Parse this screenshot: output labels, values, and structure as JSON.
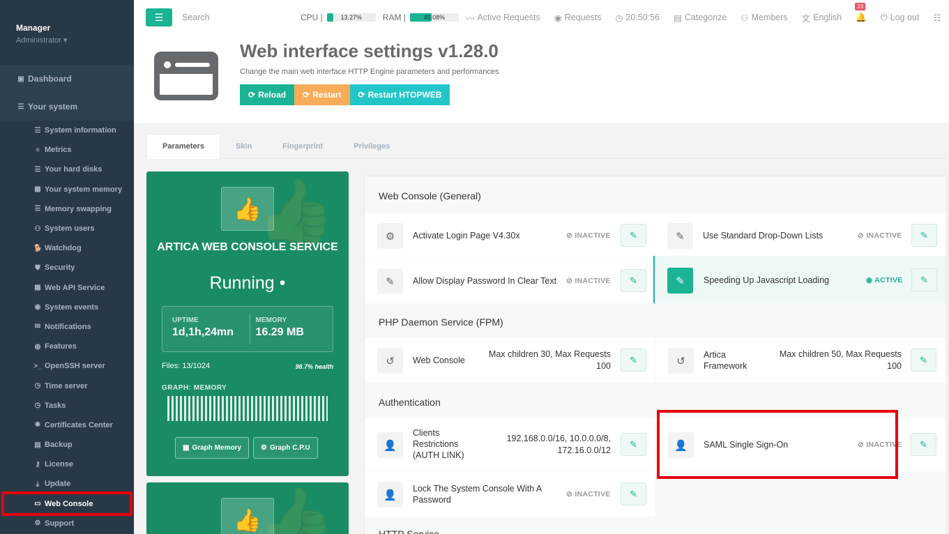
{
  "sidebar": {
    "user_name": "Manager",
    "user_role": "Administrator ▾",
    "dashboard": "Dashboard",
    "your_system": "Your system",
    "items": [
      {
        "label": "System information",
        "icon": "server-icon"
      },
      {
        "label": "Metrics",
        "icon": "list-icon"
      },
      {
        "label": "Your hard disks",
        "icon": "server-icon"
      },
      {
        "label": "Your system memory",
        "icon": "memory-icon"
      },
      {
        "label": "Memory swapping",
        "icon": "server-icon"
      },
      {
        "label": "System users",
        "icon": "users-icon"
      },
      {
        "label": "Watchdog",
        "icon": "dog-icon"
      },
      {
        "label": "Security",
        "icon": "shield-icon"
      },
      {
        "label": "Web API Service",
        "icon": "memory-icon"
      },
      {
        "label": "System events",
        "icon": "eye-icon"
      },
      {
        "label": "Notifications",
        "icon": "envelope-icon"
      },
      {
        "label": "Features",
        "icon": "globe-icon"
      },
      {
        "label": "OpenSSH server",
        "icon": "terminal-icon"
      },
      {
        "label": "Time server",
        "icon": "clock-icon"
      },
      {
        "label": "Tasks",
        "icon": "clock-icon"
      },
      {
        "label": "Certificates Center",
        "icon": "certificate-icon"
      },
      {
        "label": "Backup",
        "icon": "archive-icon"
      },
      {
        "label": "License",
        "icon": "key-icon"
      },
      {
        "label": "Update",
        "icon": "download-icon"
      },
      {
        "label": "Web Console",
        "icon": "window-icon"
      },
      {
        "label": "Support",
        "icon": "gear-icon"
      }
    ]
  },
  "topbar": {
    "search_placeholder": "Search",
    "cpu_label": "CPU |",
    "cpu_value": "13.27%",
    "cpu_percent": 13.27,
    "ram_label": "RAM |",
    "ram_value": "45.08%",
    "ram_percent": 45.08,
    "active_requests": "Active Requests",
    "requests": "Requests",
    "time": "20:50:56",
    "categorize": "Categorize",
    "members": "Members",
    "language": "English",
    "notif_count": "23",
    "logout": "Log out"
  },
  "header": {
    "title": "Web interface settings v1.28.0",
    "subtitle": "Change the main web interface HTTP Engine parameters and performances",
    "buttons": {
      "reload": "Reload",
      "restart": "Restart",
      "restart_htopweb": "Restart HTOPWEB"
    },
    "colors": {
      "reload": "#1ab394",
      "restart": "#f8ac59",
      "restart_htopweb": "#23c6c8"
    }
  },
  "tabs": [
    "Parameters",
    "Skin",
    "Fingerprint",
    "Privileges"
  ],
  "service_card": {
    "name": "ARTICA WEB CONSOLE SERVICE",
    "state": "Running •",
    "uptime_label": "UPTIME",
    "uptime": "1d,1h,24mn",
    "memory_label": "MEMORY",
    "memory": "16.29 MB",
    "files": "Files: 13/1024",
    "health": "98.7% health",
    "graph_label": "GRAPH: MEMORY",
    "btn_graph_memory": "Graph Memory",
    "btn_graph_cpu": "Graph C.P.U",
    "color": "#1a8c63"
  },
  "sections": {
    "general": {
      "title": "Web Console (General)",
      "rows": [
        {
          "label": "Activate Login Page V4.30x",
          "status": "INACTIVE"
        },
        {
          "label": "Use Standard Drop-Down Lists",
          "status": "INACTIVE"
        },
        {
          "label": "Allow Display Password In Clear Text",
          "status": "INACTIVE"
        },
        {
          "label": "Speeding Up Javascript Loading",
          "status": "ACTIVE"
        }
      ]
    },
    "php": {
      "title": "PHP Daemon Service (FPM)",
      "rows": [
        {
          "label": "Web Console",
          "value_line1": "Max children 30, Max Requests",
          "value_line2": "100"
        },
        {
          "label_line1": "Artica",
          "label_line2": "Framework",
          "value_line1": "Max children 50, Max Requests",
          "value_line2": "100"
        }
      ]
    },
    "auth": {
      "title": "Authentication",
      "rows": [
        {
          "label_line1": "Clients",
          "label_line2": "Restrictions",
          "label_line3": "(AUTH LINK)",
          "value_line1": "192.168.0.0/16, 10.0.0.0/8,",
          "value_line2": "172.16.0.0/12"
        },
        {
          "label": "SAML Single Sign-On",
          "status": "INACTIVE"
        },
        {
          "label_line1": "Lock The System Console With A",
          "label_line2": "Password",
          "status": "INACTIVE"
        }
      ]
    },
    "http_title": "HTTP Service"
  }
}
